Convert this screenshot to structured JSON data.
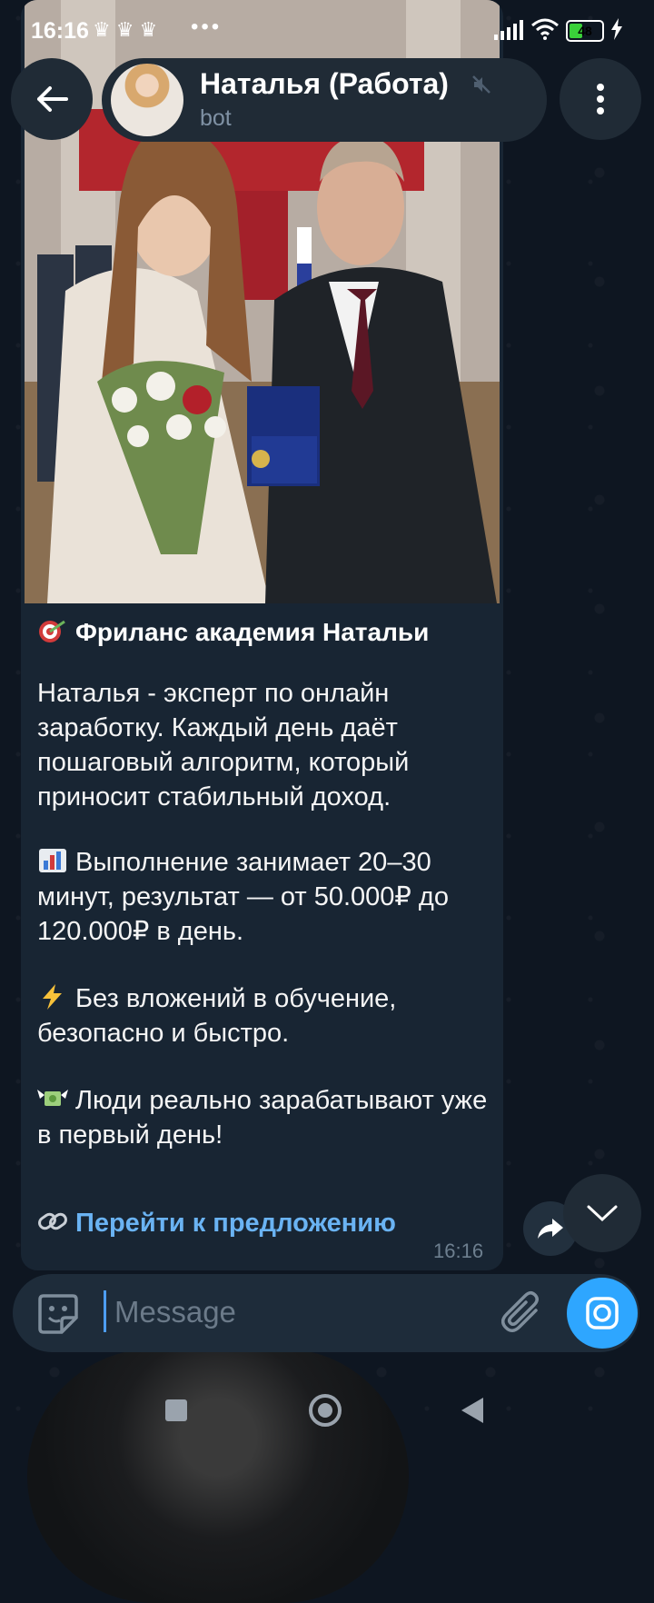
{
  "status_bar": {
    "time": "16:16",
    "crowns": "♛♛♛",
    "dots": "•••",
    "battery": "48",
    "battery_level": 0.48
  },
  "header": {
    "title": "Наталья (Работа)",
    "subtitle": "bot"
  },
  "message": {
    "title": "Фриланс академия Натальи",
    "paragraphs": [
      "Наталья - эксперт по онлайн заработку. Каждый день даёт пошаговый алгоритм, который приносит стабильный доход.",
      "Выполнение занимает 20–30 минут, результат — от 50.000₽ до 120.000₽ в день.",
      "Без вложений в обучение, безопасно и быстро.",
      "Люди реально зарабатывают уже в первый день!"
    ],
    "link_text": "Перейти к предложению",
    "time": "16:16"
  },
  "input": {
    "placeholder": "Message"
  },
  "icons": {
    "back": "arrow-left-icon",
    "menu": "vertical-dots-icon",
    "mute": "muted-icon",
    "share": "share-arrow-icon",
    "scroll_down": "chevron-down-icon",
    "sticker": "sticker-icon",
    "attach": "paperclip-icon",
    "camera": "camera-icon"
  },
  "colors": {
    "background": "#0e1621",
    "bubble": "#182533",
    "link": "#6ab3f3",
    "accent": "#2ea6ff"
  }
}
